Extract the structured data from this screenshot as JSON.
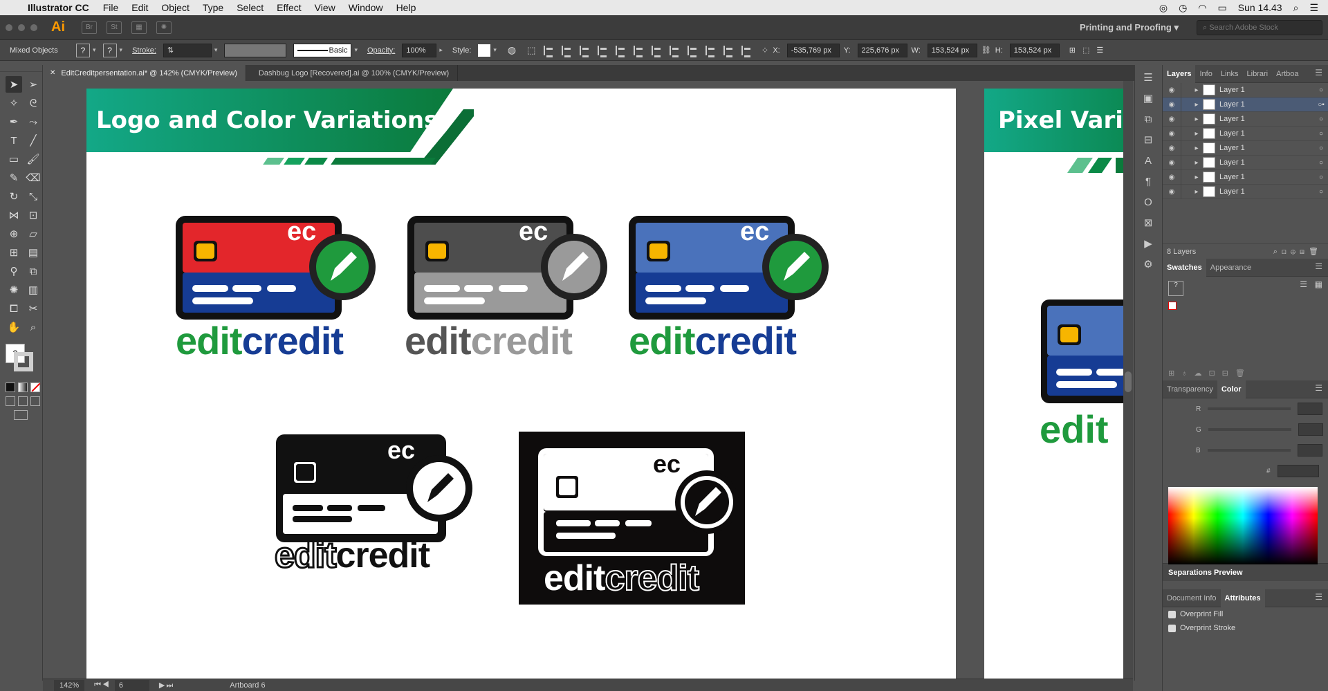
{
  "os_menu": {
    "app_name": "Illustrator CC",
    "items": [
      "File",
      "Edit",
      "Object",
      "Type",
      "Select",
      "Effect",
      "View",
      "Window",
      "Help"
    ],
    "clock": "Sun 14.43"
  },
  "appbar": {
    "logo": "Ai",
    "bridge": "Br",
    "stock": "St",
    "workspace": "Printing and Proofing",
    "search_placeholder": "Search Adobe Stock"
  },
  "control": {
    "selection": "Mixed Objects",
    "stroke_label": "Stroke:",
    "brush": "Basic",
    "opacity_label": "Opacity:",
    "opacity": "100%",
    "style_label": "Style:",
    "x_label": "X:",
    "x": "-535,769 px",
    "y_label": "Y:",
    "y": "225,676 px",
    "w_label": "W:",
    "w": "153,524 px",
    "h_label": "H:",
    "h": "153,524 px"
  },
  "tabs": [
    {
      "label": "EditCreditpersentation.ai* @ 142% (CMYK/Preview)",
      "active": true
    },
    {
      "label": "Dashbug Logo [Recovered].ai @ 100% (CMYK/Preview)",
      "active": false
    }
  ],
  "artboard1": {
    "title": "Logo and Color Variations",
    "logos": [
      {
        "variant": "red",
        "mark": "ec",
        "word1": "edit",
        "word2": "credit"
      },
      {
        "variant": "gray",
        "mark": "ec",
        "word1": "edit",
        "word2": "credit"
      },
      {
        "variant": "blue",
        "mark": "ec",
        "word1": "edit",
        "word2": "credit"
      },
      {
        "variant": "black",
        "mark": "ec",
        "word1": "edit",
        "word2": "credit"
      },
      {
        "variant": "inverse",
        "mark": "ec",
        "word1": "edit",
        "word2": "credit"
      }
    ]
  },
  "artboard2": {
    "title": "Pixel Varia",
    "word": "edit"
  },
  "status": {
    "zoom": "142%",
    "page": "6",
    "artboard": "Artboard 6"
  },
  "layers_panel": {
    "tabs": [
      "Layers",
      "Info",
      "Links",
      "Librari",
      "Artboa"
    ],
    "layers": [
      "Layer 1",
      "Layer 1",
      "Layer 1",
      "Layer 1",
      "Layer 1",
      "Layer 1",
      "Layer 1",
      "Layer 1"
    ],
    "count": "8 Layers"
  },
  "swatches_panel": {
    "tabs": [
      "Swatches",
      "Appearance"
    ]
  },
  "color_panel": {
    "tabs": [
      "Transparency",
      "Color"
    ],
    "channels": [
      "R",
      "G",
      "B"
    ],
    "hex_label": "#"
  },
  "sep_panel": {
    "title": "Separations Preview"
  },
  "attr_panel": {
    "tabs": [
      "Document Info",
      "Attributes"
    ],
    "options": [
      "Overprint Fill",
      "Overprint Stroke"
    ]
  },
  "colors": {
    "brand_green": "#1f9a3d",
    "brand_blue": "#163c94",
    "card_red": "#e3262b",
    "card_blue": "#4a72bb",
    "banner_green": "#0d9a6b"
  }
}
